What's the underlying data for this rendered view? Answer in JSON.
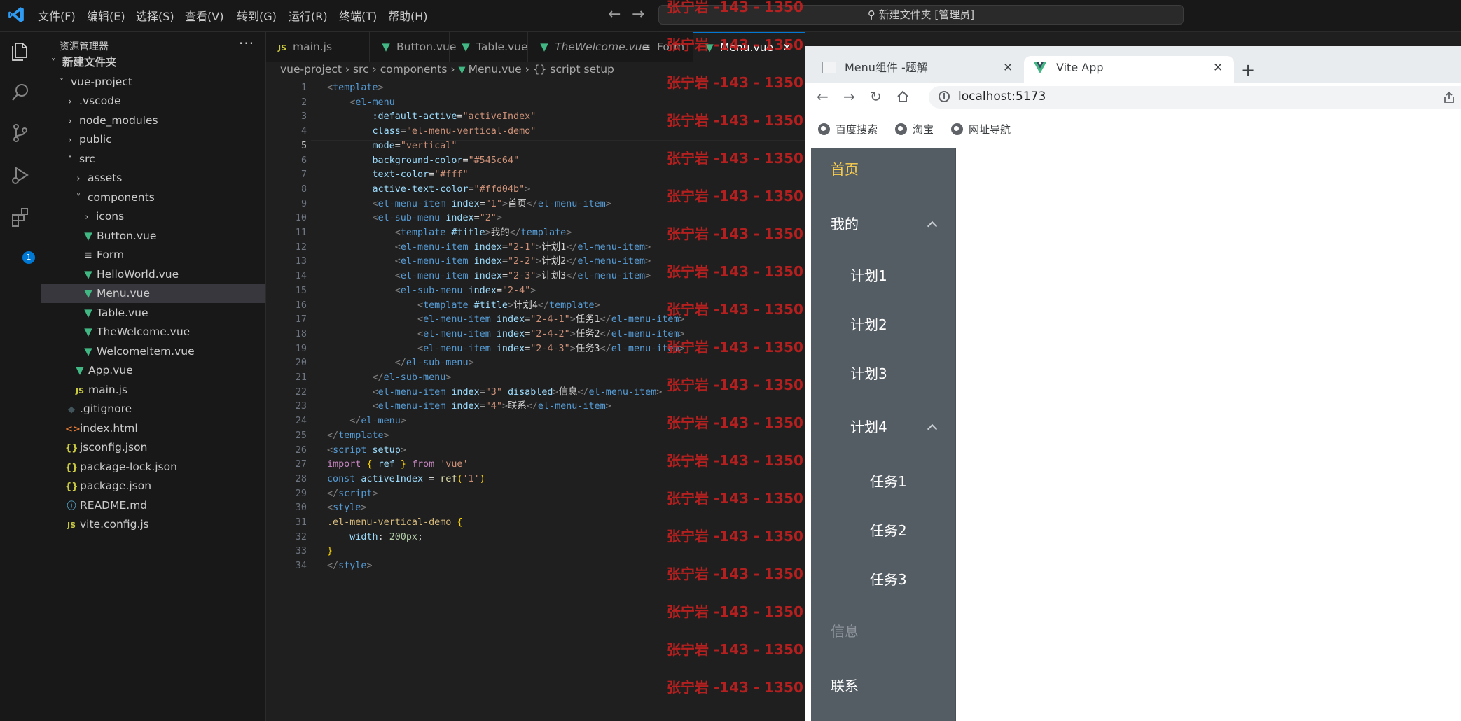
{
  "titlebar": {
    "menus": [
      "文件(F)",
      "编辑(E)",
      "选择(S)",
      "查看(V)",
      "转到(G)",
      "运行(R)",
      "终端(T)",
      "帮助(H)"
    ],
    "command_center": "新建文件夹 [管理员]"
  },
  "activity_badge": "1",
  "explorer": {
    "title": "资源管理器",
    "more": "···",
    "tree": [
      {
        "label": "新建文件夹",
        "type": "folder-open",
        "depth": 0
      },
      {
        "label": "vue-project",
        "type": "folder-open",
        "depth": 1
      },
      {
        "label": ".vscode",
        "type": "folder",
        "depth": 2
      },
      {
        "label": "node_modules",
        "type": "folder",
        "depth": 2
      },
      {
        "label": "public",
        "type": "folder",
        "depth": 2
      },
      {
        "label": "src",
        "type": "folder-open",
        "depth": 2
      },
      {
        "label": "assets",
        "type": "folder",
        "depth": 3
      },
      {
        "label": "components",
        "type": "folder-open",
        "depth": 3
      },
      {
        "label": "icons",
        "type": "folder",
        "depth": 4
      },
      {
        "label": "Button.vue",
        "type": "vue",
        "depth": 4
      },
      {
        "label": "Form",
        "type": "form",
        "depth": 4
      },
      {
        "label": "HelloWorld.vue",
        "type": "vue",
        "depth": 4
      },
      {
        "label": "Menu.vue",
        "type": "vue",
        "depth": 4,
        "selected": true
      },
      {
        "label": "Table.vue",
        "type": "vue",
        "depth": 4
      },
      {
        "label": "TheWelcome.vue",
        "type": "vue",
        "depth": 4
      },
      {
        "label": "WelcomeItem.vue",
        "type": "vue",
        "depth": 4
      },
      {
        "label": "App.vue",
        "type": "vue",
        "depth": 3
      },
      {
        "label": "main.js",
        "type": "js",
        "depth": 3
      },
      {
        "label": ".gitignore",
        "type": "git",
        "depth": 2
      },
      {
        "label": "index.html",
        "type": "html",
        "depth": 2
      },
      {
        "label": "jsconfig.json",
        "type": "json",
        "depth": 2
      },
      {
        "label": "package-lock.json",
        "type": "json",
        "depth": 2
      },
      {
        "label": "package.json",
        "type": "json",
        "depth": 2
      },
      {
        "label": "README.md",
        "type": "info",
        "depth": 2
      },
      {
        "label": "vite.config.js",
        "type": "js",
        "depth": 2
      }
    ]
  },
  "editor_tabs": [
    {
      "label": "main.js",
      "type": "js"
    },
    {
      "label": "Button.vue",
      "type": "vue"
    },
    {
      "label": "Table.vue",
      "type": "vue"
    },
    {
      "label": "TheWelcome.vue",
      "type": "vue"
    },
    {
      "label": "Form",
      "type": "form"
    },
    {
      "label": "Menu.vue",
      "type": "vue",
      "active": true
    }
  ],
  "breadcrumb": [
    "vue-project",
    "src",
    "components",
    "Menu.vue",
    "{} script setup"
  ],
  "current_line": 5,
  "code_lines": [
    [
      [
        "br",
        "<"
      ],
      [
        "tg",
        "template"
      ],
      [
        "br",
        ">"
      ]
    ],
    [
      [
        "tx",
        "    "
      ],
      [
        "br",
        "<"
      ],
      [
        "tg",
        "el-menu"
      ]
    ],
    [
      [
        "tx",
        "        "
      ],
      [
        "at",
        ":default-active"
      ],
      [
        "tx",
        "="
      ],
      [
        "st",
        "\"activeIndex\""
      ]
    ],
    [
      [
        "tx",
        "        "
      ],
      [
        "at",
        "class"
      ],
      [
        "tx",
        "="
      ],
      [
        "st",
        "\"el-menu-vertical-demo\""
      ]
    ],
    [
      [
        "tx",
        "        "
      ],
      [
        "at",
        "mode"
      ],
      [
        "tx",
        "="
      ],
      [
        "st",
        "\"vertical\""
      ]
    ],
    [
      [
        "tx",
        "        "
      ],
      [
        "at",
        "background-color"
      ],
      [
        "tx",
        "="
      ],
      [
        "st",
        "\"#545c64\""
      ]
    ],
    [
      [
        "tx",
        "        "
      ],
      [
        "at",
        "text-color"
      ],
      [
        "tx",
        "="
      ],
      [
        "st",
        "\"#fff\""
      ]
    ],
    [
      [
        "tx",
        "        "
      ],
      [
        "at",
        "active-text-color"
      ],
      [
        "tx",
        "="
      ],
      [
        "st",
        "\"#ffd04b\""
      ],
      [
        "br",
        ">"
      ]
    ],
    [
      [
        "tx",
        "        "
      ],
      [
        "br",
        "<"
      ],
      [
        "tg",
        "el-menu-item"
      ],
      [
        "tx",
        " "
      ],
      [
        "at",
        "index"
      ],
      [
        "tx",
        "="
      ],
      [
        "st",
        "\"1\""
      ],
      [
        "br",
        ">"
      ],
      [
        "tx",
        "首页"
      ],
      [
        "br",
        "</"
      ],
      [
        "tg",
        "el-menu-item"
      ],
      [
        "br",
        ">"
      ]
    ],
    [
      [
        "tx",
        "        "
      ],
      [
        "br",
        "<"
      ],
      [
        "tg",
        "el-sub-menu"
      ],
      [
        "tx",
        " "
      ],
      [
        "at",
        "index"
      ],
      [
        "tx",
        "="
      ],
      [
        "st",
        "\"2\""
      ],
      [
        "br",
        ">"
      ]
    ],
    [
      [
        "tx",
        "            "
      ],
      [
        "br",
        "<"
      ],
      [
        "tg",
        "template"
      ],
      [
        "tx",
        " "
      ],
      [
        "at",
        "#title"
      ],
      [
        "br",
        ">"
      ],
      [
        "tx",
        "我的"
      ],
      [
        "br",
        "</"
      ],
      [
        "tg",
        "template"
      ],
      [
        "br",
        ">"
      ]
    ],
    [
      [
        "tx",
        "            "
      ],
      [
        "br",
        "<"
      ],
      [
        "tg",
        "el-menu-item"
      ],
      [
        "tx",
        " "
      ],
      [
        "at",
        "index"
      ],
      [
        "tx",
        "="
      ],
      [
        "st",
        "\"2-1\""
      ],
      [
        "br",
        ">"
      ],
      [
        "tx",
        "计划1"
      ],
      [
        "br",
        "</"
      ],
      [
        "tg",
        "el-menu-item"
      ],
      [
        "br",
        ">"
      ]
    ],
    [
      [
        "tx",
        "            "
      ],
      [
        "br",
        "<"
      ],
      [
        "tg",
        "el-menu-item"
      ],
      [
        "tx",
        " "
      ],
      [
        "at",
        "index"
      ],
      [
        "tx",
        "="
      ],
      [
        "st",
        "\"2-2\""
      ],
      [
        "br",
        ">"
      ],
      [
        "tx",
        "计划2"
      ],
      [
        "br",
        "</"
      ],
      [
        "tg",
        "el-menu-item"
      ],
      [
        "br",
        ">"
      ]
    ],
    [
      [
        "tx",
        "            "
      ],
      [
        "br",
        "<"
      ],
      [
        "tg",
        "el-menu-item"
      ],
      [
        "tx",
        " "
      ],
      [
        "at",
        "index"
      ],
      [
        "tx",
        "="
      ],
      [
        "st",
        "\"2-3\""
      ],
      [
        "br",
        ">"
      ],
      [
        "tx",
        "计划3"
      ],
      [
        "br",
        "</"
      ],
      [
        "tg",
        "el-menu-item"
      ],
      [
        "br",
        ">"
      ]
    ],
    [
      [
        "tx",
        "            "
      ],
      [
        "br",
        "<"
      ],
      [
        "tg",
        "el-sub-menu"
      ],
      [
        "tx",
        " "
      ],
      [
        "at",
        "index"
      ],
      [
        "tx",
        "="
      ],
      [
        "st",
        "\"2-4\""
      ],
      [
        "br",
        ">"
      ]
    ],
    [
      [
        "tx",
        "                "
      ],
      [
        "br",
        "<"
      ],
      [
        "tg",
        "template"
      ],
      [
        "tx",
        " "
      ],
      [
        "at",
        "#title"
      ],
      [
        "br",
        ">"
      ],
      [
        "tx",
        "计划4"
      ],
      [
        "br",
        "</"
      ],
      [
        "tg",
        "template"
      ],
      [
        "br",
        ">"
      ]
    ],
    [
      [
        "tx",
        "                "
      ],
      [
        "br",
        "<"
      ],
      [
        "tg",
        "el-menu-item"
      ],
      [
        "tx",
        " "
      ],
      [
        "at",
        "index"
      ],
      [
        "tx",
        "="
      ],
      [
        "st",
        "\"2-4-1\""
      ],
      [
        "br",
        ">"
      ],
      [
        "tx",
        "任务1"
      ],
      [
        "br",
        "</"
      ],
      [
        "tg",
        "el-menu-item"
      ],
      [
        "br",
        ">"
      ]
    ],
    [
      [
        "tx",
        "                "
      ],
      [
        "br",
        "<"
      ],
      [
        "tg",
        "el-menu-item"
      ],
      [
        "tx",
        " "
      ],
      [
        "at",
        "index"
      ],
      [
        "tx",
        "="
      ],
      [
        "st",
        "\"2-4-2\""
      ],
      [
        "br",
        ">"
      ],
      [
        "tx",
        "任务2"
      ],
      [
        "br",
        "</"
      ],
      [
        "tg",
        "el-menu-item"
      ],
      [
        "br",
        ">"
      ]
    ],
    [
      [
        "tx",
        "                "
      ],
      [
        "br",
        "<"
      ],
      [
        "tg",
        "el-menu-item"
      ],
      [
        "tx",
        " "
      ],
      [
        "at",
        "index"
      ],
      [
        "tx",
        "="
      ],
      [
        "st",
        "\"2-4-3\""
      ],
      [
        "br",
        ">"
      ],
      [
        "tx",
        "任务3"
      ],
      [
        "br",
        "</"
      ],
      [
        "tg",
        "el-menu-item"
      ],
      [
        "br",
        ">"
      ]
    ],
    [
      [
        "tx",
        "            "
      ],
      [
        "br",
        "</"
      ],
      [
        "tg",
        "el-sub-menu"
      ],
      [
        "br",
        ">"
      ]
    ],
    [
      [
        "tx",
        "        "
      ],
      [
        "br",
        "</"
      ],
      [
        "tg",
        "el-sub-menu"
      ],
      [
        "br",
        ">"
      ]
    ],
    [
      [
        "tx",
        "        "
      ],
      [
        "br",
        "<"
      ],
      [
        "tg",
        "el-menu-item"
      ],
      [
        "tx",
        " "
      ],
      [
        "at",
        "index"
      ],
      [
        "tx",
        "="
      ],
      [
        "st",
        "\"3\""
      ],
      [
        "tx",
        " "
      ],
      [
        "at",
        "disabled"
      ],
      [
        "br",
        ">"
      ],
      [
        "tx",
        "信息"
      ],
      [
        "br",
        "</"
      ],
      [
        "tg",
        "el-menu-item"
      ],
      [
        "br",
        ">"
      ]
    ],
    [
      [
        "tx",
        "        "
      ],
      [
        "br",
        "<"
      ],
      [
        "tg",
        "el-menu-item"
      ],
      [
        "tx",
        " "
      ],
      [
        "at",
        "index"
      ],
      [
        "tx",
        "="
      ],
      [
        "st",
        "\"4\""
      ],
      [
        "br",
        ">"
      ],
      [
        "tx",
        "联系"
      ],
      [
        "br",
        "</"
      ],
      [
        "tg",
        "el-menu-item"
      ],
      [
        "br",
        ">"
      ]
    ],
    [
      [
        "tx",
        "    "
      ],
      [
        "br",
        "</"
      ],
      [
        "tg",
        "el-menu"
      ],
      [
        "br",
        ">"
      ]
    ],
    [
      [
        "br",
        "</"
      ],
      [
        "tg",
        "template"
      ],
      [
        "br",
        ">"
      ]
    ],
    [
      [
        "br",
        "<"
      ],
      [
        "tg",
        "script"
      ],
      [
        "tx",
        " "
      ],
      [
        "at",
        "setup"
      ],
      [
        "br",
        ">"
      ]
    ],
    [
      [
        "kw",
        "import"
      ],
      [
        "tx",
        " "
      ],
      [
        "yb",
        "{"
      ],
      [
        "tx",
        " "
      ],
      [
        "pr",
        "ref"
      ],
      [
        "tx",
        " "
      ],
      [
        "yb",
        "}"
      ],
      [
        "tx",
        " "
      ],
      [
        "kw",
        "from"
      ],
      [
        "tx",
        " "
      ],
      [
        "st",
        "'vue'"
      ]
    ],
    [
      [
        "tg",
        "const"
      ],
      [
        "tx",
        " "
      ],
      [
        "pr",
        "activeIndex"
      ],
      [
        "tx",
        " = "
      ],
      [
        "fn",
        "ref"
      ],
      [
        "yb",
        "("
      ],
      [
        "st",
        "'1'"
      ],
      [
        "yb",
        ")"
      ]
    ],
    [
      [
        "br",
        "</"
      ],
      [
        "tg",
        "script"
      ],
      [
        "br",
        ">"
      ]
    ],
    [
      [
        "br",
        "<"
      ],
      [
        "tg",
        "style"
      ],
      [
        "br",
        ">"
      ]
    ],
    [
      [
        "sl",
        ".el-menu-vertical-demo"
      ],
      [
        "tx",
        " "
      ],
      [
        "yb",
        "{"
      ]
    ],
    [
      [
        "tx",
        "    "
      ],
      [
        "pr",
        "width"
      ],
      [
        "tx",
        ": "
      ],
      [
        "nm",
        "200px"
      ],
      [
        "tx",
        ";"
      ]
    ],
    [
      [
        "yb",
        "}"
      ]
    ],
    [
      [
        "br",
        "</"
      ],
      [
        "tg",
        "style"
      ],
      [
        "br",
        ">"
      ]
    ]
  ],
  "watermark": "张宁岩 -143 - 1350",
  "browser": {
    "tabs": [
      {
        "label": "Menu组件 -题解",
        "active": false
      },
      {
        "label": "Vite App",
        "active": true
      }
    ],
    "new_tab": "+",
    "url": "localhost:5173",
    "bookmarks": [
      "百度搜索",
      "淘宝",
      "网址导航"
    ]
  },
  "el_menu": {
    "colors": {
      "background": "#545c64",
      "text": "#ffffff",
      "active_text": "#ffd04b"
    },
    "items": [
      {
        "label": "首页",
        "level": 0,
        "active": true
      },
      {
        "label": "我的",
        "level": 0,
        "submenu": true
      },
      {
        "label": "计划1",
        "level": 1
      },
      {
        "label": "计划2",
        "level": 1
      },
      {
        "label": "计划3",
        "level": 1
      },
      {
        "label": "计划4",
        "level": 1,
        "submenu": true
      },
      {
        "label": "任务1",
        "level": 2
      },
      {
        "label": "任务2",
        "level": 2
      },
      {
        "label": "任务3",
        "level": 2
      },
      {
        "label": "信息",
        "level": 0,
        "disabled": true
      },
      {
        "label": "联系",
        "level": 0
      }
    ]
  }
}
